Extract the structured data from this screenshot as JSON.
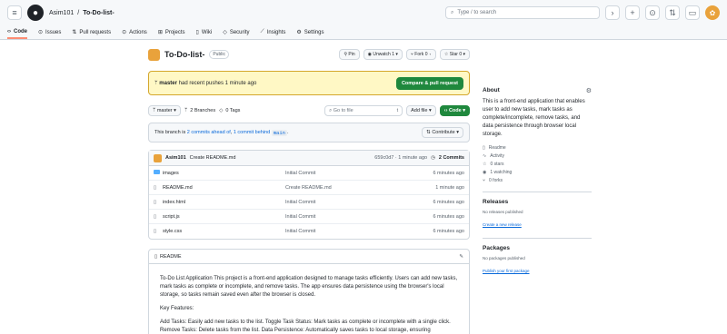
{
  "header": {
    "owner": "Asim101",
    "separator": "/",
    "repo": "To-Do-list-",
    "search_placeholder": "Type / to search"
  },
  "nav": {
    "tabs": [
      {
        "label": "Code"
      },
      {
        "label": "Issues"
      },
      {
        "label": "Pull requests"
      },
      {
        "label": "Actions"
      },
      {
        "label": "Projects"
      },
      {
        "label": "Wiki"
      },
      {
        "label": "Security"
      },
      {
        "label": "Insights"
      },
      {
        "label": "Settings"
      }
    ]
  },
  "repo": {
    "name": "To-Do-list-",
    "visibility": "Public",
    "pin": "Pin",
    "unwatch": "Unwatch",
    "unwatch_count": "1",
    "fork": "Fork",
    "fork_count": "0",
    "star": "Star",
    "star_count": "0"
  },
  "push_banner": {
    "branch": "master",
    "text": "had recent pushes 1 minute ago",
    "button": "Compare & pull request"
  },
  "toolbar": {
    "branch": "master",
    "branches": "2 Branches",
    "tags": "0 Tags",
    "goto_placeholder": "Go to file",
    "goto_key": "t",
    "add_file": "Add file",
    "code": "Code"
  },
  "ahead": {
    "prefix": "This branch is",
    "commits_ahead": "2 commits ahead of",
    "middle": ",",
    "commit_behind": "1 commit behind",
    "base": "main",
    "contribute": "Contribute"
  },
  "commit": {
    "author": "Asim101",
    "message": "Create README.md",
    "meta": "659c0d7 · 1 minute ago",
    "count": "2 Commits"
  },
  "files": [
    {
      "name": "images",
      "message": "Initial Commit",
      "age": "6 minutes ago",
      "type": "folder"
    },
    {
      "name": "README.md",
      "message": "Create README.md",
      "age": "1 minute ago",
      "type": "file"
    },
    {
      "name": "index.html",
      "message": "Initial Commit",
      "age": "6 minutes ago",
      "type": "file"
    },
    {
      "name": "script.js",
      "message": "Initial Commit",
      "age": "6 minutes ago",
      "type": "file"
    },
    {
      "name": "style.css",
      "message": "Initial Commit",
      "age": "6 minutes ago",
      "type": "file"
    }
  ],
  "readme": {
    "title": "README",
    "p1": "To-Do List Application This project is a front-end application designed to manage tasks efficiently. Users can add new tasks, mark tasks as complete or incomplete, and remove tasks. The app ensures data persistence using the browser's local storage, so tasks remain saved even after the browser is closed.",
    "p2": "Key Features:",
    "p3": "Add Tasks: Easily add new tasks to the list. Toggle Task Status: Mark tasks as complete or incomplete with a single click. Remove Tasks: Delete tasks from the list. Data Persistence: Automatically saves tasks to local storage, ensuring"
  },
  "about": {
    "title": "About",
    "description": "This is a front-end application that enables user to add new tasks, mark tasks as complete/incomplete, remove tasks, and data persistence through browser local storage.",
    "stats": [
      "Readme",
      "Activity",
      "0 stars",
      "1 watching",
      "0 forks"
    ]
  },
  "releases": {
    "title": "Releases",
    "none": "No releases published",
    "link": "Create a new release"
  },
  "packages": {
    "title": "Packages",
    "none": "No packages published",
    "link": "Publish your first package"
  }
}
